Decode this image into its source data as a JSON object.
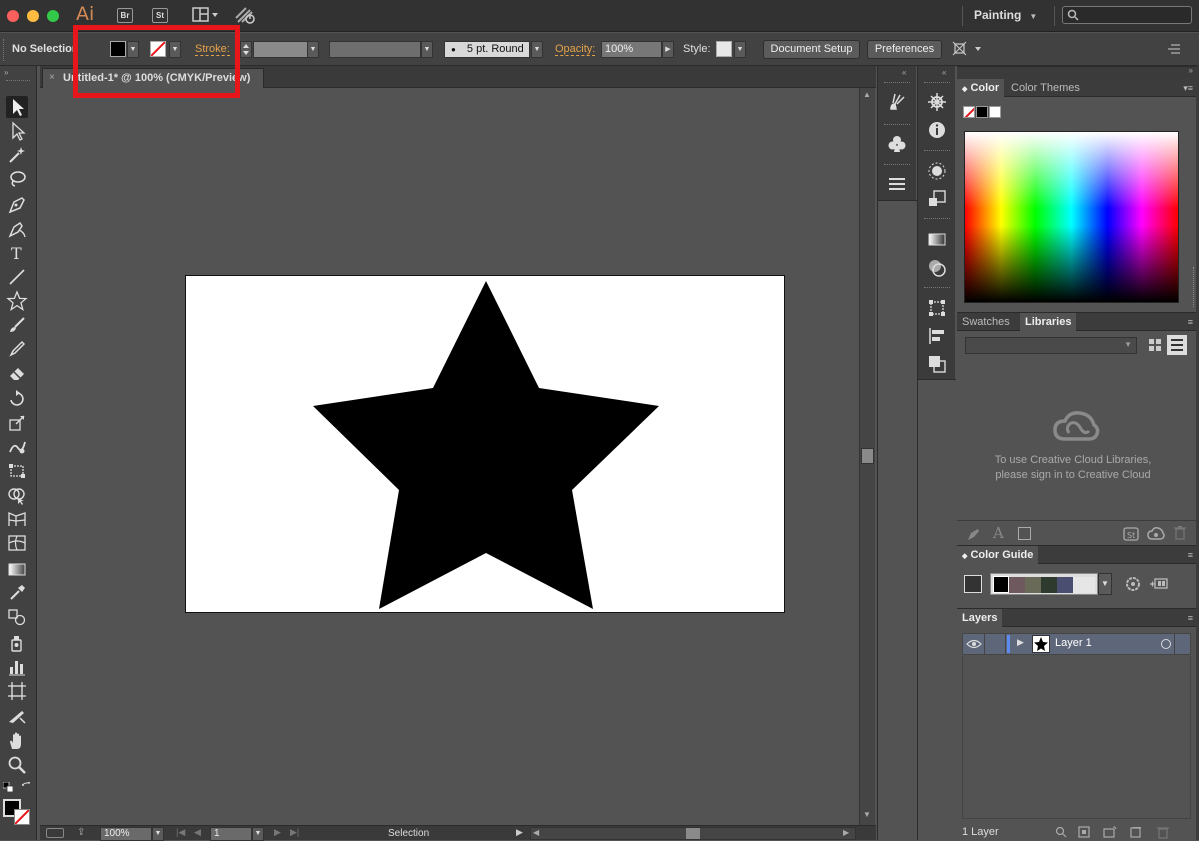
{
  "window": {
    "app_logo": "Ai",
    "bridge_label": "Br",
    "stock_label": "St",
    "workspace": "Painting",
    "colors": {
      "close": "#fc605c",
      "minimize": "#fdbc40",
      "maximize": "#34c84a"
    }
  },
  "control_bar": {
    "selection_label": "No Selection",
    "stroke_label": "Stroke:",
    "brush_label": "5 pt. Round",
    "opacity_label": "Opacity:",
    "opacity_value": "100%",
    "style_label": "Style:",
    "document_setup": "Document Setup",
    "preferences": "Preferences",
    "accent_color": "#e6a34a",
    "highlight_color": "#e8161b"
  },
  "document": {
    "tab_title": "Untitled-1* @ 100% (CMYK/Preview)",
    "close_glyph": "×"
  },
  "status_bar": {
    "zoom": "100%",
    "page": "1",
    "tool_name": "Selection"
  },
  "color_panel": {
    "tabs": [
      "Color",
      "Color Themes"
    ]
  },
  "libraries_panel": {
    "tabs": [
      "Swatches",
      "Libraries"
    ],
    "message_line1": "To use Creative Cloud Libraries,",
    "message_line2": "please sign in to Creative Cloud",
    "text_glyph": "A"
  },
  "color_guide_panel": {
    "title": "Color Guide",
    "guide_colors": [
      "#000000",
      "#6e5a5e",
      "#6a6a58",
      "#2f3a2f",
      "#4a4f72",
      "#e6e6e6"
    ]
  },
  "layers_panel": {
    "title": "Layers",
    "layer_name": "Layer 1",
    "layer_count": "1 Layer",
    "layer_color": "#5b8af0"
  },
  "icons": {
    "tools": [
      "selection-tool-icon",
      "direct-selection-tool-icon",
      "magic-wand-icon",
      "lasso-icon",
      "pen-tool-icon",
      "curvature-tool-icon",
      "type-tool-icon",
      "line-tool-icon",
      "star-tool-icon",
      "paintbrush-icon",
      "pencil-icon",
      "eraser-icon",
      "rotate-tool-icon",
      "scale-tool-icon",
      "puppet-warp-icon",
      "free-transform-icon",
      "shape-builder-icon",
      "perspective-grid-icon",
      "mesh-tool-icon",
      "gradient-tool-icon",
      "eyedropper-icon",
      "blend-tool-icon",
      "symbol-sprayer-icon",
      "column-graph-icon",
      "artboard-tool-icon",
      "slice-tool-icon",
      "hand-tool-icon",
      "zoom-tool-icon"
    ]
  }
}
